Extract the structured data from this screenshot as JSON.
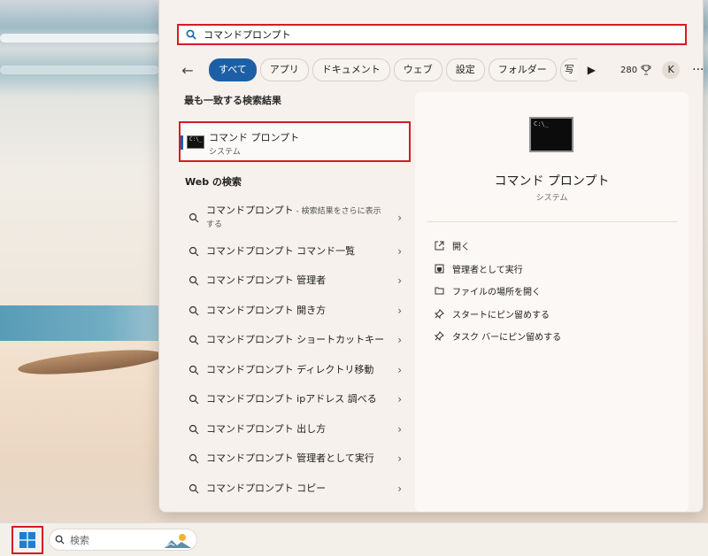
{
  "search": {
    "query": "コマンドプロンプト"
  },
  "tabs": [
    {
      "label": "すべて",
      "active": true
    },
    {
      "label": "アプリ"
    },
    {
      "label": "ドキュメント"
    },
    {
      "label": "ウェブ"
    },
    {
      "label": "設定"
    },
    {
      "label": "フォルダー"
    },
    {
      "label": "写"
    }
  ],
  "toolbar": {
    "more_glyph": "▶",
    "points": "280",
    "avatar_initial": "K",
    "ellipsis": "···",
    "back_glyph": "←"
  },
  "best_match": {
    "section_title": "最も一致する検索結果",
    "title": "コマンド プロンプト",
    "subtitle": "システム"
  },
  "web": {
    "section_title": "Web の検索",
    "items": [
      {
        "label": "コマンドプロンプト",
        "suffix": " - 検索結果をさらに表示する"
      },
      {
        "label": "コマンドプロンプト コマンド一覧"
      },
      {
        "label": "コマンドプロンプト 管理者"
      },
      {
        "label": "コマンドプロンプト 開き方"
      },
      {
        "label": "コマンドプロンプト ショートカットキー"
      },
      {
        "label": "コマンドプロンプト ディレクトリ移動"
      },
      {
        "label": "コマンドプロンプト ipアドレス 調べる"
      },
      {
        "label": "コマンドプロンプト 出し方"
      },
      {
        "label": "コマンドプロンプト 管理者として実行"
      },
      {
        "label": "コマンドプロンプト コピー"
      }
    ]
  },
  "detail": {
    "title": "コマンド プロンプト",
    "subtitle": "システム",
    "actions": [
      {
        "label": "開く",
        "icon": "open-external-icon"
      },
      {
        "label": "管理者として実行",
        "icon": "shield-icon"
      },
      {
        "label": "ファイルの場所を開く",
        "icon": "folder-icon"
      },
      {
        "label": "スタートにピン留めする",
        "icon": "pin-icon"
      },
      {
        "label": "タスク バーにピン留めする",
        "icon": "pin-icon"
      }
    ]
  },
  "taskbar": {
    "search_placeholder": "検索"
  },
  "colors": {
    "accent": "#1d5fa6",
    "highlight_border": "#d41c24",
    "panel_bg": "#f6f1ec"
  }
}
